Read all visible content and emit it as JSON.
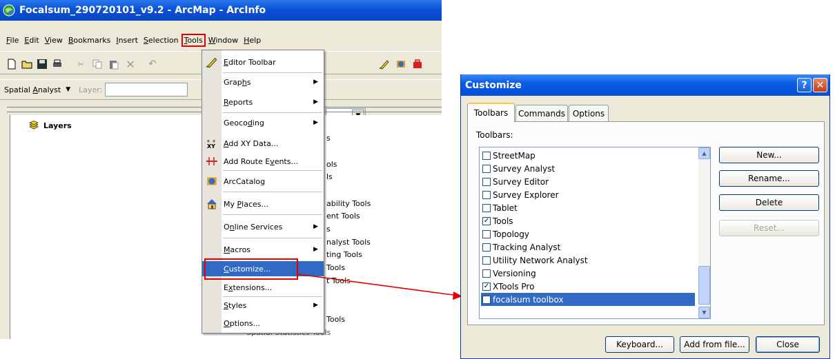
{
  "arcmap": {
    "title": "Focalsum_290720101_v9.2 - ArcMap - ArcInfo",
    "menubar": [
      "File",
      "Edit",
      "View",
      "Bookmarks",
      "Insert",
      "Selection",
      "Tools",
      "Window",
      "Help"
    ],
    "active_menu": "Tools",
    "toolbar2": {
      "spatial_analyst_pre": "Spatial ",
      "spatial_analyst_ul": "A",
      "spatial_analyst_post": "nalyst",
      "layer_label": "Layer:"
    },
    "toc": {
      "root": "Layers",
      "background_items": [
        "s",
        "ols",
        "ls",
        "ability Tools",
        "ent Tools",
        "s",
        "nalyst Tools",
        "ting Tools",
        "Tools",
        "t Tools",
        "Tools",
        "Spatial Statistics Tools"
      ]
    }
  },
  "tools_menu": {
    "items": [
      {
        "pre": "",
        "ul": "E",
        "post": "ditor Toolbar",
        "icon": "editor-icon",
        "submenu": false
      },
      {
        "pre": "Grap",
        "ul": "h",
        "post": "s",
        "icon": "",
        "submenu": true
      },
      {
        "pre": "",
        "ul": "R",
        "post": "eports",
        "icon": "",
        "submenu": true
      },
      {
        "pre": "Geoco",
        "ul": "d",
        "post": "ing",
        "icon": "",
        "submenu": true
      },
      {
        "pre": "",
        "ul": "A",
        "post": "dd XY Data...",
        "icon": "xy-data-icon",
        "submenu": false
      },
      {
        "pre": "Add Route E",
        "ul": "v",
        "post": "ents...",
        "icon": "route-events-icon",
        "submenu": false
      },
      {
        "pre": "ArcCatalo",
        "ul": "g",
        "post": "",
        "icon": "arccatalog-icon",
        "submenu": false
      },
      {
        "pre": "My ",
        "ul": "P",
        "post": "laces...",
        "icon": "home-icon",
        "submenu": false
      },
      {
        "pre": "O",
        "ul": "n",
        "post": "line Services",
        "icon": "",
        "submenu": true
      },
      {
        "pre": "",
        "ul": "M",
        "post": "acros",
        "icon": "",
        "submenu": true
      },
      {
        "pre": "",
        "ul": "C",
        "post": "ustomize...",
        "icon": "",
        "submenu": false,
        "highlighted": true
      },
      {
        "pre": "E",
        "ul": "x",
        "post": "tensions...",
        "icon": "",
        "submenu": false
      },
      {
        "pre": "",
        "ul": "S",
        "post": "tyles",
        "icon": "",
        "submenu": true
      },
      {
        "pre": "",
        "ul": "O",
        "post": "ptions...",
        "icon": "",
        "submenu": false
      }
    ]
  },
  "customize_dialog": {
    "title": "Customize",
    "help_glyph": "?",
    "close_glyph": "✕",
    "tabs": [
      "Toolbars",
      "Commands",
      "Options"
    ],
    "toolbars_label": "Toolbars:",
    "toolbars": [
      {
        "name": "StreetMap",
        "checked": false
      },
      {
        "name": "Survey Analyst",
        "checked": false
      },
      {
        "name": "Survey Editor",
        "checked": false
      },
      {
        "name": "Survey Explorer",
        "checked": false
      },
      {
        "name": "Tablet",
        "checked": false
      },
      {
        "name": "Tools",
        "checked": true
      },
      {
        "name": "Topology",
        "checked": false
      },
      {
        "name": "Tracking Analyst",
        "checked": false
      },
      {
        "name": "Utility Network Analyst",
        "checked": false
      },
      {
        "name": "Versioning",
        "checked": false
      },
      {
        "name": "XTools Pro",
        "checked": true
      },
      {
        "name": "focalsum toolbox",
        "checked": false,
        "selected": true
      }
    ],
    "side_buttons": {
      "new": "New...",
      "rename": "Rename...",
      "delete": "Delete",
      "reset": "Reset..."
    },
    "bottom_buttons": {
      "keyboard": "Keyboard...",
      "add_from_file": "Add from file...",
      "close": "Close"
    }
  },
  "colors": {
    "accent": "#316ac5",
    "annotation": "#e00000",
    "titlebar": "#0a5ce6"
  }
}
